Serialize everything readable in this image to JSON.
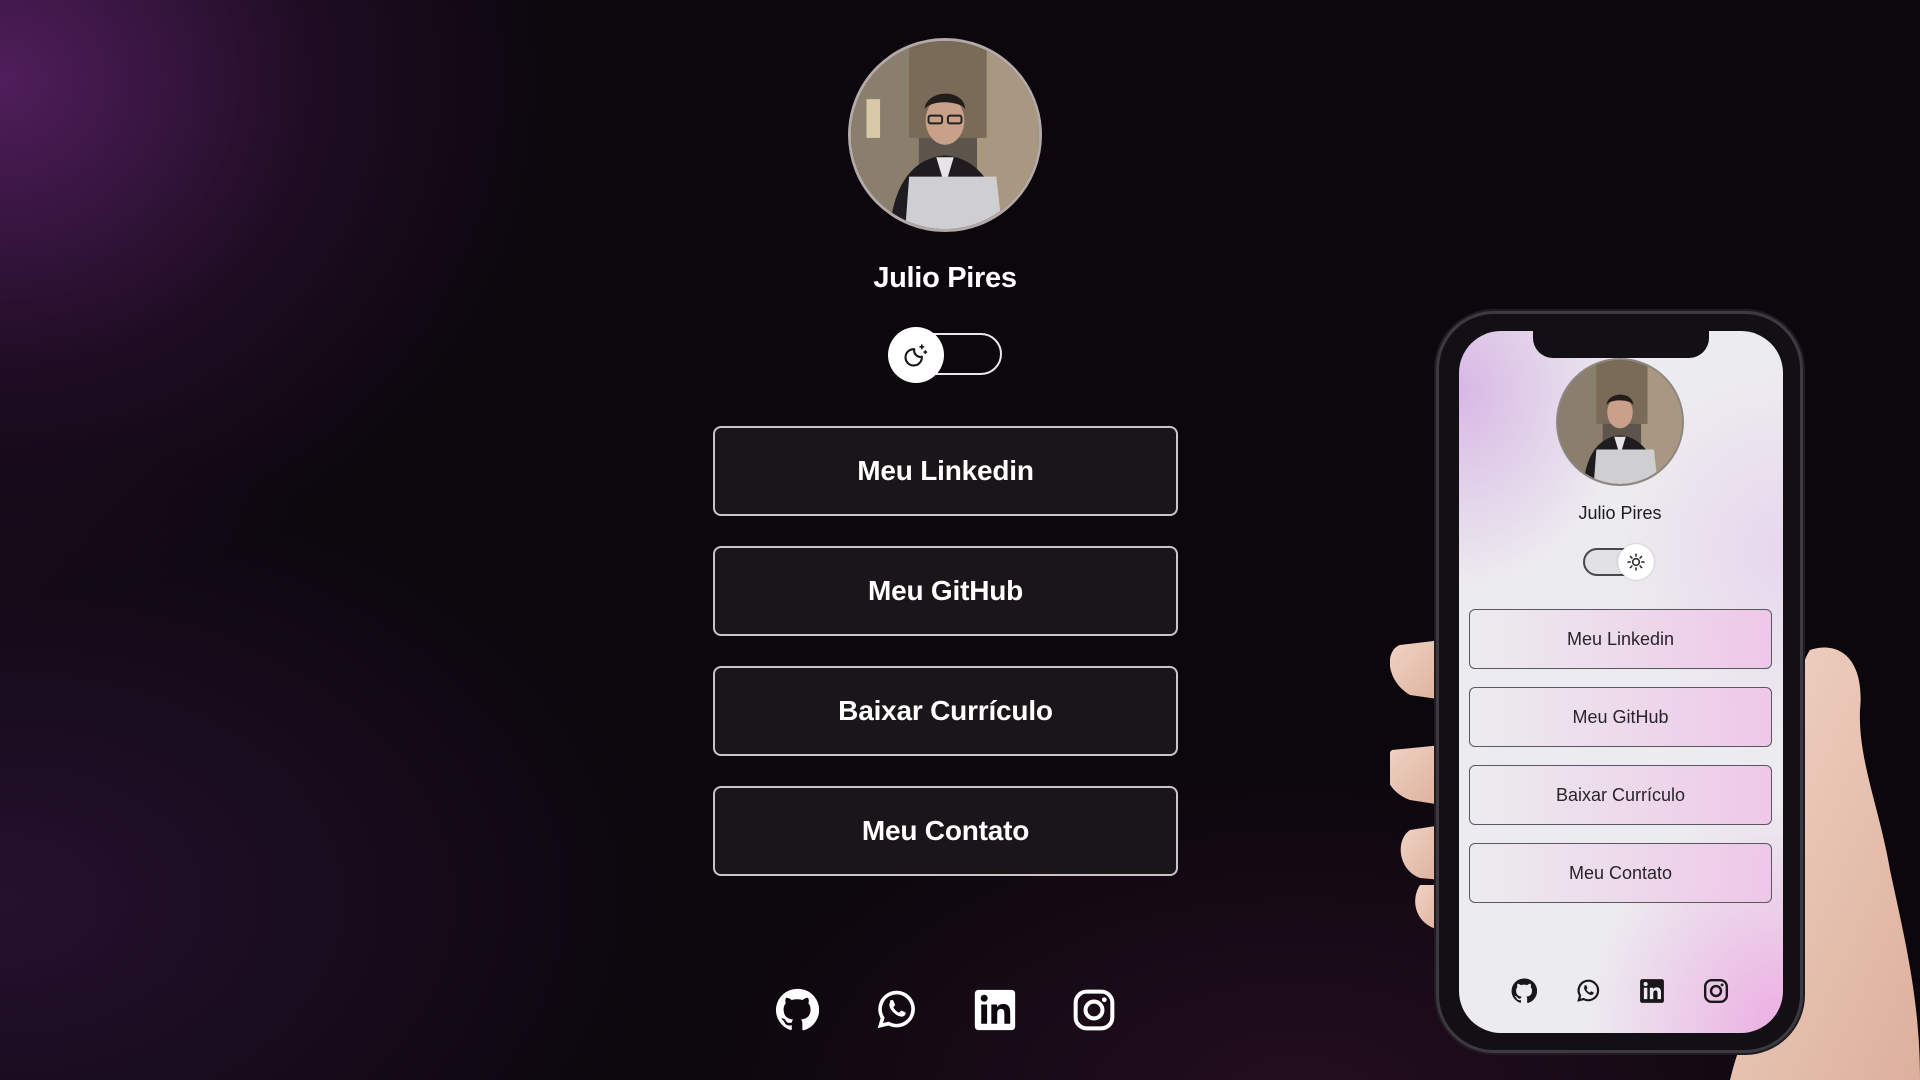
{
  "profile": {
    "name": "Julio Pires",
    "avatar_icon": "profile-photo",
    "theme_toggle": {
      "state": "dark",
      "icon": "moon-icon"
    }
  },
  "links": [
    {
      "label": "Meu Linkedin"
    },
    {
      "label": "Meu GitHub"
    },
    {
      "label": "Baixar Currículo"
    },
    {
      "label": "Meu Contato"
    }
  ],
  "social": [
    {
      "icon": "github-icon"
    },
    {
      "icon": "whatsapp-icon"
    },
    {
      "icon": "linkedin-icon"
    },
    {
      "icon": "instagram-icon"
    }
  ],
  "phone_preview": {
    "name": "Julio Pires",
    "theme_toggle": {
      "state": "light",
      "icon": "sun-icon"
    },
    "links": [
      {
        "label": "Meu Linkedin"
      },
      {
        "label": "Meu GitHub"
      },
      {
        "label": "Baixar Currículo"
      },
      {
        "label": "Meu Contato"
      }
    ]
  },
  "colors": {
    "background": "#0b070c",
    "accent_purple": "#5c226a",
    "button_bg": "#1a1519",
    "button_border": "#c9c4c8",
    "text_light": "#ffffff",
    "phone_accent_pink": "#ecaae2"
  }
}
